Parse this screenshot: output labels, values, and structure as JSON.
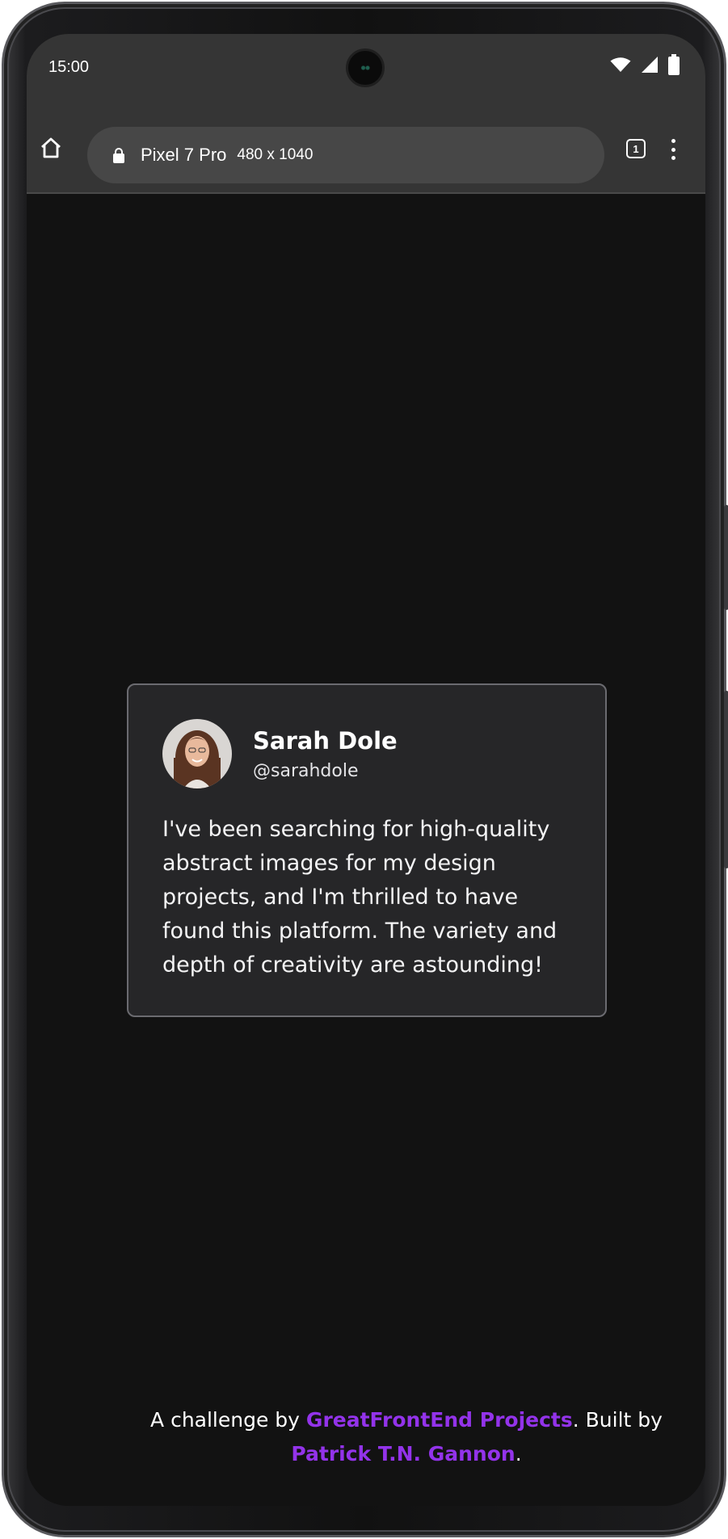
{
  "status_bar": {
    "time": "15:00",
    "icons": [
      "wifi-icon",
      "signal-icon",
      "battery-icon"
    ]
  },
  "browser": {
    "device_name": "Pixel 7 Pro",
    "device_size": "480 x 1040",
    "tab_count": "1",
    "icons": [
      "home-icon",
      "lock-icon",
      "tabs-icon",
      "more-vert-icon"
    ]
  },
  "testimonial": {
    "name": "Sarah Dole",
    "handle": "@sarahdole",
    "text": "I've been searching for high-quality abstract images for my design projects, and I'm thrilled to have found this platform. The variety and depth of creativity are astounding!"
  },
  "footer": {
    "prefix": "A challenge by ",
    "challenge_link": "GreatFrontEnd Projects",
    "middle": ". Built by ",
    "author_link": "Patrick T.N. Gannon",
    "suffix": "."
  },
  "colors": {
    "page_background": "#121212",
    "card_background": "#262628",
    "card_border": "#6b6b70",
    "link": "#9333ea",
    "chrome_bar": "#353535"
  }
}
